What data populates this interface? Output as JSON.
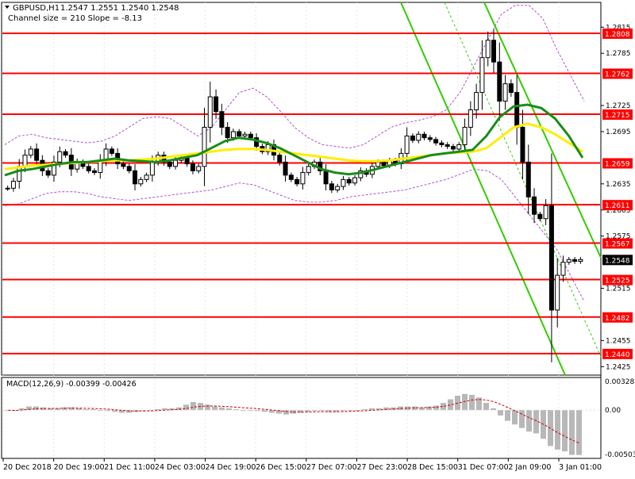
{
  "header": {
    "symbol": "GBPUSD,H1",
    "ohlc": "1.2547 1.2551 1.2540 1.2548",
    "channel_info": "Channel size = 210 Slope = -8.13"
  },
  "macd": {
    "title": "MACD(12,26,9) -0.00399 -0.00426",
    "ticks": [
      "0.00328",
      "0.00",
      "-0.00503"
    ]
  },
  "colors": {
    "level_line": "#ff0000",
    "level_label_bg": "#ff0000",
    "price_label_bg": "#000000",
    "ma_fast": "#1a8c1a",
    "ma_slow": "#ffee00",
    "channel": "#33cc00",
    "bollinger": "#b44fd4",
    "candle": "#000000",
    "macd_hist": "#b8b8b8",
    "macd_signal": "#cc0000"
  },
  "chart_data": {
    "type": "candlestick",
    "y_axis_ticks": [
      "1.2815",
      "1.2785",
      "1.2725",
      "1.2695",
      "1.2635",
      "1.2605",
      "1.2575",
      "1.2515",
      "1.2455",
      "1.2425"
    ],
    "levels": [
      "1.2808",
      "1.2762",
      "1.2715",
      "1.2659",
      "1.2611",
      "1.2567",
      "1.2525",
      "1.2482",
      "1.2440"
    ],
    "current_price": "1.2548",
    "x_labels": [
      "20 Dec 2018",
      "20 Dec 19:00",
      "21 Dec 11:00",
      "24 Dec 03:00",
      "24 Dec 19:00",
      "26 Dec 15:00",
      "27 Dec 07:00",
      "27 Dec 23:00",
      "28 Dec 15:00",
      "31 Dec 07:00",
      "2 Jan 09:00",
      "3 Jan 01:00"
    ],
    "close_path": [
      1.263,
      1.2638,
      1.2655,
      1.2668,
      1.2675,
      1.2662,
      1.265,
      1.2645,
      1.266,
      1.2672,
      1.2668,
      1.2652,
      1.266,
      1.2655,
      1.265,
      1.2648,
      1.2662,
      1.2675,
      1.267,
      1.2658,
      1.2655,
      1.265,
      1.2635,
      1.264,
      1.2645,
      1.266,
      1.2668,
      1.266,
      1.2655,
      1.2662,
      1.2665,
      1.2658,
      1.265,
      1.2655,
      1.27,
      1.2735,
      1.2718,
      1.27,
      1.2688,
      1.2695,
      1.269,
      1.2692,
      1.2688,
      1.2678,
      1.2672,
      1.268,
      1.2668,
      1.266,
      1.2645,
      1.264,
      1.2635,
      1.2648,
      1.2655,
      1.266,
      1.265,
      1.2635,
      1.2628,
      1.2632,
      1.264,
      1.2636,
      1.2642,
      1.265,
      1.2646,
      1.2655,
      1.266,
      1.2656,
      1.2662,
      1.2658,
      1.267,
      1.269,
      1.2685,
      1.2692,
      1.2688,
      1.2686,
      1.2682,
      1.268,
      1.2678,
      1.2675,
      1.268,
      1.27,
      1.272,
      1.274,
      1.278,
      1.28,
      1.2775,
      1.273,
      1.275,
      1.274,
      1.27,
      1.266,
      1.262,
      1.26,
      1.2595,
      1.261,
      1.249,
      1.253,
      1.2545,
      1.2548,
      1.2546,
      1.2548
    ],
    "ma_fast_path": [
      1.2645,
      1.265,
      1.2652,
      1.2655,
      1.2658,
      1.266,
      1.266,
      1.2662,
      1.2664,
      1.2662,
      1.2661,
      1.266,
      1.2662,
      1.2665,
      1.2668,
      1.2676,
      1.2684,
      1.2688,
      1.2686,
      1.2682,
      1.2676,
      1.2668,
      1.266,
      1.2652,
      1.2648,
      1.2646,
      1.2648,
      1.2652,
      1.2656,
      1.266,
      1.2664,
      1.2668,
      1.267,
      1.2672,
      1.2674,
      1.269,
      1.2712,
      1.2724,
      1.2726,
      1.2722,
      1.271,
      1.269,
      1.2665
    ],
    "ma_slow_path": [
      1.2652,
      1.2654,
      1.2656,
      1.2657,
      1.2658,
      1.2659,
      1.266,
      1.2661,
      1.2662,
      1.2662,
      1.2663,
      1.2664,
      1.2666,
      1.2668,
      1.267,
      1.2672,
      1.2674,
      1.2675,
      1.2675,
      1.2674,
      1.2672,
      1.267,
      1.2668,
      1.2666,
      1.2664,
      1.2662,
      1.2661,
      1.2661,
      1.2662,
      1.2664,
      1.2666,
      1.2668,
      1.267,
      1.2671,
      1.2672,
      1.2676,
      1.2688,
      1.27,
      1.2704,
      1.27,
      1.2692,
      1.2682,
      1.2672
    ],
    "bb_upper_path": [
      1.268,
      1.269,
      1.2692,
      1.2688,
      1.2686,
      1.2684,
      1.2682,
      1.2684,
      1.269,
      1.27,
      1.271,
      1.2712,
      1.271,
      1.27,
      1.269,
      1.27,
      1.272,
      1.274,
      1.2745,
      1.2735,
      1.2718,
      1.27,
      1.2688,
      1.268,
      1.2678,
      1.2676,
      1.268,
      1.269,
      1.27,
      1.2705,
      1.2708,
      1.2712,
      1.272,
      1.274,
      1.277,
      1.28,
      1.283,
      1.284,
      1.284,
      1.2825,
      1.279,
      1.276,
      1.273
    ],
    "bb_lower_path": [
      1.261,
      1.2612,
      1.2618,
      1.2624,
      1.2626,
      1.2626,
      1.2624,
      1.262,
      1.2618,
      1.2616,
      1.2618,
      1.262,
      1.2622,
      1.2624,
      1.2626,
      1.2628,
      1.2632,
      1.2636,
      1.2634,
      1.2628,
      1.2622,
      1.2616,
      1.2614,
      1.2614,
      1.2616,
      1.262,
      1.2622,
      1.2624,
      1.2626,
      1.2628,
      1.2632,
      1.2636,
      1.264,
      1.2646,
      1.2652,
      1.265,
      1.264,
      1.262,
      1.26,
      1.258,
      1.256,
      1.253,
      1.25
    ],
    "macd_hist": [
      -0.0001,
      -0.0001,
      0.0002,
      0.0004,
      0.0004,
      0.0003,
      0.0002,
      0.0002,
      0.0003,
      0.0003,
      0.0002,
      0.0001,
      0.0001,
      0.0,
      -0.0001,
      -0.0002,
      -0.0003,
      -0.0003,
      -0.0002,
      -0.0001,
      0.0,
      0.0001,
      0.0002,
      0.0002,
      0.0003,
      0.0006,
      0.0009,
      0.0008,
      0.0006,
      0.0004,
      0.0003,
      0.0002,
      0.0001,
      0.0,
      0.0,
      -0.0001,
      -0.0002,
      -0.0003,
      -0.0004,
      -0.0005,
      -0.0004,
      -0.0003,
      -0.0002,
      -0.0001,
      -0.0001,
      -0.0002,
      -0.0002,
      -0.0001,
      0.0,
      0.0,
      0.0001,
      0.0002,
      0.0002,
      0.0003,
      0.0003,
      0.0004,
      0.0004,
      0.0004,
      0.0003,
      0.0004,
      0.0005,
      0.0008,
      0.0012,
      0.0016,
      0.0018,
      0.0017,
      0.0014,
      0.0008,
      0.0002,
      -0.0006,
      -0.0012,
      -0.0016,
      -0.002,
      -0.0024,
      -0.0026,
      -0.0032,
      -0.004,
      -0.0044,
      -0.0046,
      -0.005,
      -0.005
    ]
  }
}
